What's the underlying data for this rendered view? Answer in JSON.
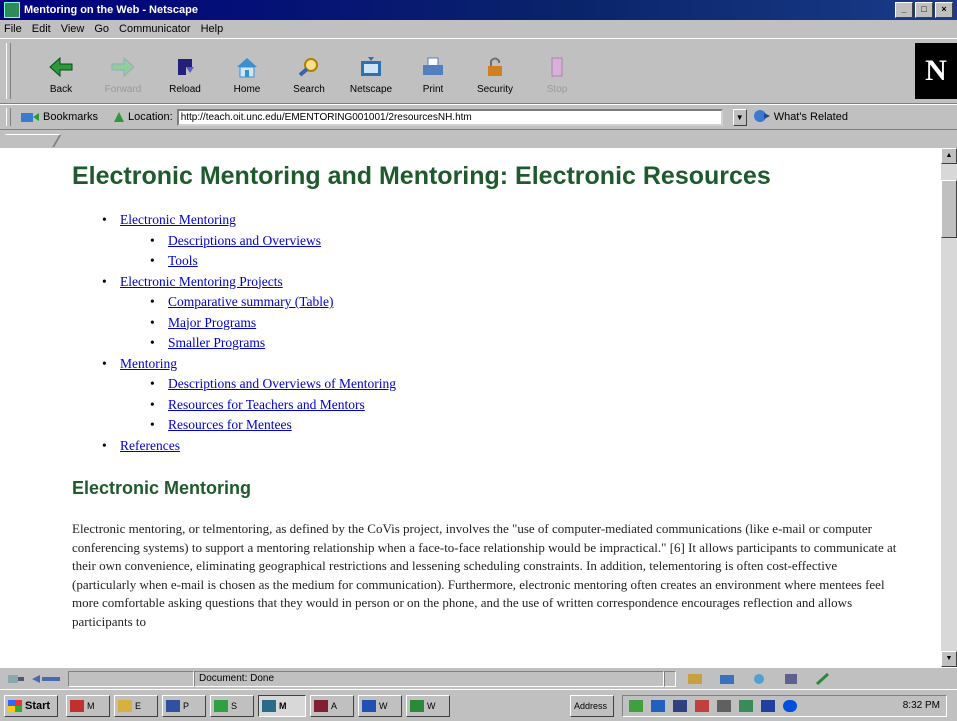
{
  "window": {
    "title": "Mentoring on the Web - Netscape",
    "controls": [
      "_",
      "□",
      "×"
    ]
  },
  "menu": [
    "File",
    "Edit",
    "View",
    "Go",
    "Communicator",
    "Help"
  ],
  "toolbar": {
    "buttons": [
      {
        "label": "Back",
        "icon": "back-arrow-icon",
        "color": "#2a9a3a",
        "enabled": true
      },
      {
        "label": "Forward",
        "icon": "forward-arrow-icon",
        "color": "#2a9a3a",
        "enabled": false
      },
      {
        "label": "Reload",
        "icon": "reload-icon",
        "color": "#22207a",
        "enabled": true
      },
      {
        "label": "Home",
        "icon": "home-icon",
        "color": "#3a8fcf",
        "enabled": true
      },
      {
        "label": "Search",
        "icon": "search-icon",
        "color": "#e0b000",
        "enabled": true
      },
      {
        "label": "Netscape",
        "icon": "netscape-icon",
        "color": "#3070b0",
        "enabled": true
      },
      {
        "label": "Print",
        "icon": "print-icon",
        "color": "#5080c0",
        "enabled": true
      },
      {
        "label": "Security",
        "icon": "lock-icon",
        "color": "#d08020",
        "enabled": true
      },
      {
        "label": "Stop",
        "icon": "stop-icon",
        "color": "#b080b0",
        "enabled": false
      }
    ],
    "logo": "N"
  },
  "location_bar": {
    "bookmarks_label": "Bookmarks",
    "location_label": "Location:",
    "url": "http://teach.oit.unc.edu/EMENTORING001001/2resourcesNH.htm",
    "whats_related": "What's Related"
  },
  "page": {
    "heading": "Electronic Mentoring and Mentoring: Electronic Resources",
    "toc": [
      {
        "text": "Electronic Mentoring",
        "level": 1
      },
      {
        "text": "Descriptions and Overviews",
        "level": 2
      },
      {
        "text": "Tools",
        "level": 2
      },
      {
        "text": "Electronic Mentoring Projects",
        "level": 1
      },
      {
        "text": "Comparative summary (Table)",
        "level": 2
      },
      {
        "text": "Major Programs",
        "level": 2
      },
      {
        "text": "Smaller Programs",
        "level": 2
      },
      {
        "text": "Mentoring",
        "level": 1
      },
      {
        "text": "Descriptions and Overviews of Mentoring",
        "level": 2
      },
      {
        "text": "Resources for Teachers and Mentors",
        "level": 2
      },
      {
        "text": "Resources for Mentees",
        "level": 2
      },
      {
        "text": "References",
        "level": 1
      }
    ],
    "section_heading": "Electronic Mentoring",
    "paragraph": "Electronic mentoring, or telmentoring, as defined by the CoVis project, involves the \"use of computer-mediated communications (like e-mail or computer conferencing systems) to support a mentoring relationship when a face-to-face relationship would be impractical.\" [6]  It allows participants to communicate at their own convenience, eliminating geographical restrictions and lessening scheduling constraints. In addition, telementoring is often cost-effective (particularly when e-mail is chosen as the medium for communication).  Furthermore, electronic mentoring often creates an environment where mentees feel more comfortable asking questions that they would in person or on the phone, and the use of written correspondence encourages reflection and allows participants to"
  },
  "status": {
    "text": "Document: Done"
  },
  "taskbar": {
    "start_label": "Start",
    "tasks": [
      {
        "label": "M",
        "color": "#c03030"
      },
      {
        "label": "E",
        "color": "#d8b040"
      },
      {
        "label": "P",
        "color": "#3050a0"
      },
      {
        "label": "S",
        "color": "#30a040"
      },
      {
        "label": "M",
        "color": "#2a6a8a",
        "active": true
      },
      {
        "label": "A",
        "color": "#802030"
      },
      {
        "label": "W",
        "color": "#2050b0"
      },
      {
        "label": "W",
        "color": "#2a8a3a"
      }
    ],
    "address_label": "Address",
    "clock": "8:32 PM"
  },
  "colors": {
    "heading_green": "#1e5a2c",
    "link_blue": "#0000cc",
    "title_bar": "#000080"
  }
}
